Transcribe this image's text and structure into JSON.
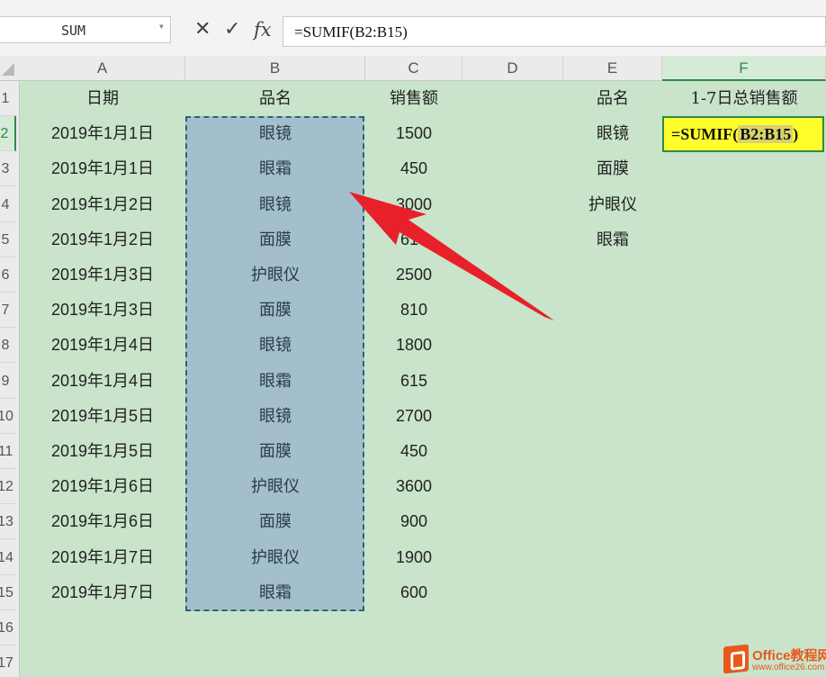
{
  "formula_bar": {
    "name_box": "SUM",
    "cancel_glyph": "✕",
    "confirm_glyph": "✓",
    "fx_glyph": "fx",
    "formula": "=SUMIF(B2:B15)"
  },
  "columns": [
    "A",
    "B",
    "C",
    "D",
    "E",
    "F"
  ],
  "active_column": "F",
  "rows": [
    "1",
    "2",
    "3",
    "4",
    "5",
    "6",
    "7",
    "8",
    "9",
    "10",
    "11",
    "12",
    "13",
    "14",
    "15",
    "16",
    "17"
  ],
  "active_row": "2",
  "table": {
    "headers": {
      "date": "日期",
      "product": "品名",
      "sales": "销售额"
    },
    "records": [
      [
        "2019年1月1日",
        "眼镜",
        "1500"
      ],
      [
        "2019年1月1日",
        "眼霜",
        "450"
      ],
      [
        "2019年1月2日",
        "眼镜",
        "3000"
      ],
      [
        "2019年1月2日",
        "面膜",
        "615"
      ],
      [
        "2019年1月3日",
        "护眼仪",
        "2500"
      ],
      [
        "2019年1月3日",
        "面膜",
        "810"
      ],
      [
        "2019年1月4日",
        "眼镜",
        "1800"
      ],
      [
        "2019年1月4日",
        "眼霜",
        "615"
      ],
      [
        "2019年1月5日",
        "眼镜",
        "2700"
      ],
      [
        "2019年1月5日",
        "面膜",
        "450"
      ],
      [
        "2019年1月6日",
        "护眼仪",
        "3600"
      ],
      [
        "2019年1月6日",
        "面膜",
        "900"
      ],
      [
        "2019年1月7日",
        "护眼仪",
        "1900"
      ],
      [
        "2019年1月7日",
        "眼霜",
        "600"
      ]
    ]
  },
  "summary": {
    "header_product": "品名",
    "header_total": "1-7日总销售额",
    "products": [
      "眼镜",
      "面膜",
      "护眼仪",
      "眼霜"
    ],
    "editing_formula_prefix": "=SUMIF(",
    "editing_formula_ref": "B2:B15",
    "editing_formula_suffix": ")"
  },
  "watermark": {
    "name": "Office教程网",
    "url": "www.office26.com"
  },
  "colors": {
    "sheet_bg": "#c9e4cb",
    "selection": "#a3bfcd",
    "active_cell": "#fffd2c",
    "arrow": "#e8202a",
    "accent": "#2e8b43"
  }
}
